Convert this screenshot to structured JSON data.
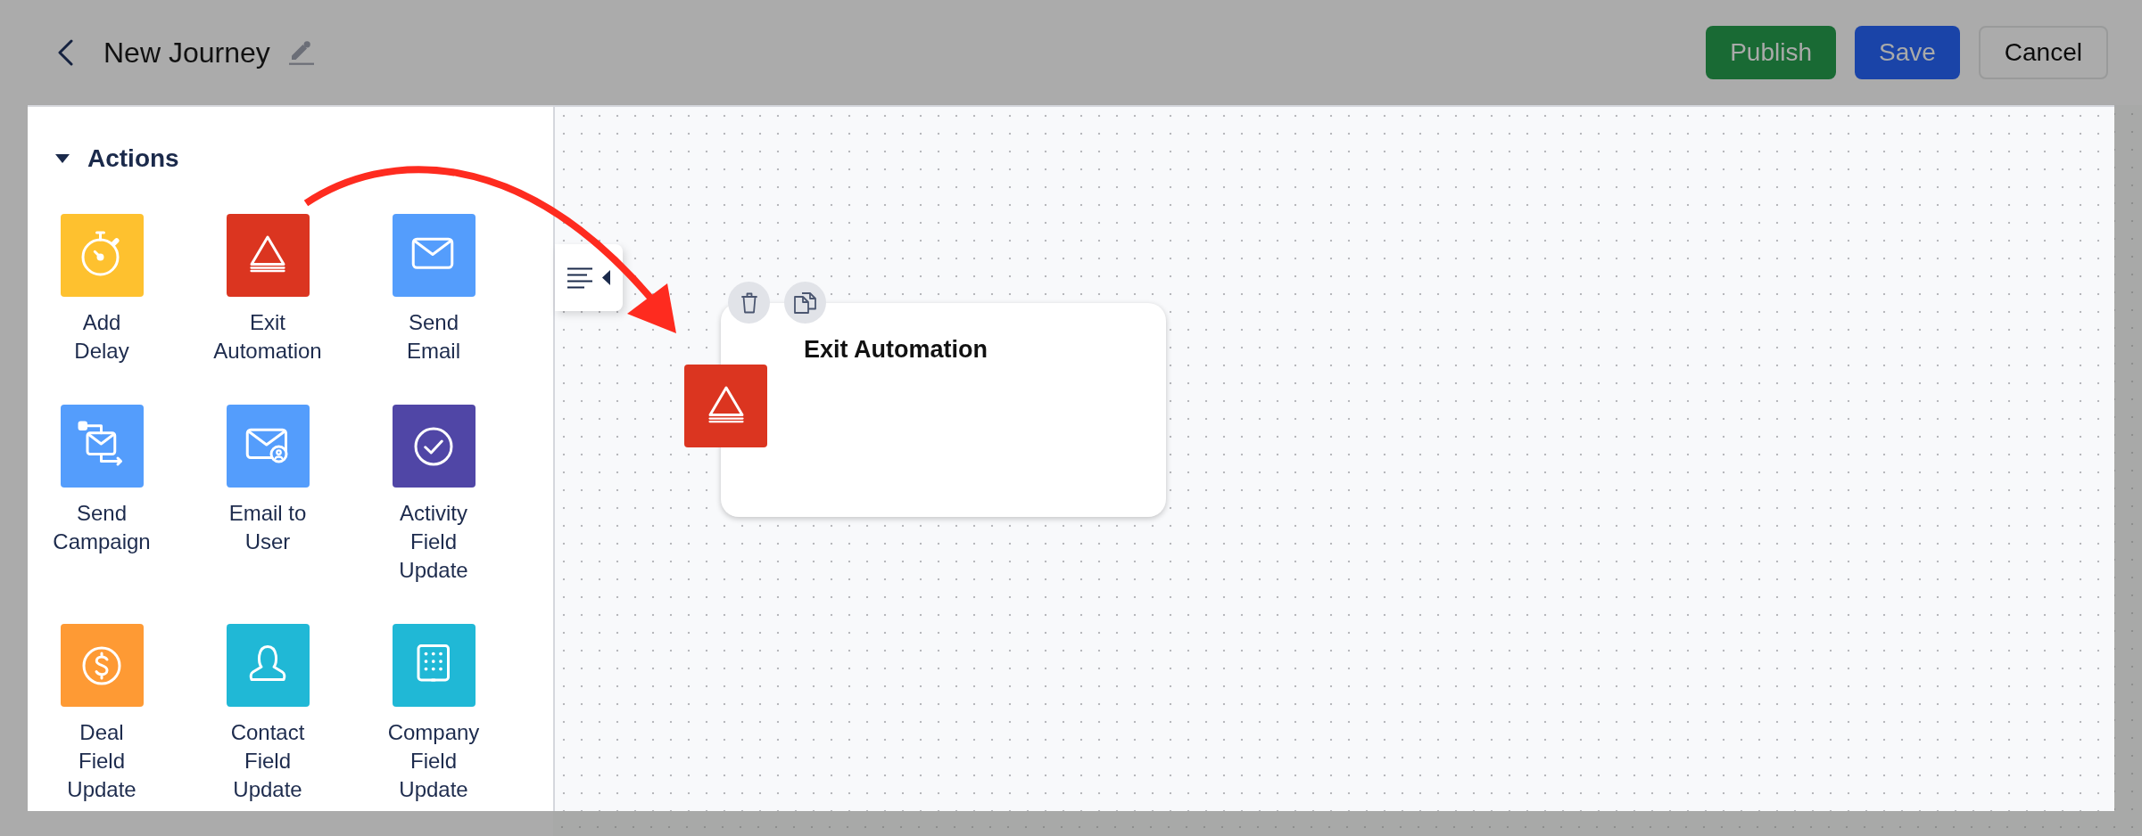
{
  "header": {
    "title": "New Journey",
    "buttons": [
      {
        "label": "Publish",
        "kind": "publish"
      },
      {
        "label": "Save",
        "kind": "save"
      },
      {
        "label": "Cancel",
        "kind": "cancel"
      }
    ]
  },
  "sidebar": {
    "section": {
      "title": "Actions",
      "expanded": true
    },
    "items": [
      {
        "label": "Add Delay",
        "kind": "stopwatch",
        "color": "#fec12f"
      },
      {
        "label": "Exit Automation",
        "kind": "exit",
        "color": "#db3520"
      },
      {
        "label": "Send Email",
        "kind": "email",
        "color": "#549dfc"
      },
      {
        "label": "Send Campaign",
        "kind": "campaign",
        "color": "#549dfc"
      },
      {
        "label": "Email to User",
        "kind": "email_user",
        "color": "#549dfc"
      },
      {
        "label": "Activity Field Update",
        "kind": "check",
        "color": "#5046a6"
      },
      {
        "label": "Deal Field Update",
        "kind": "deal",
        "color": "#fe9a34"
      },
      {
        "label": "Contact Field Update",
        "kind": "contact",
        "color": "#20b8d6"
      },
      {
        "label": "Company Field Update",
        "kind": "company",
        "color": "#20b8d6"
      }
    ]
  },
  "canvas": {
    "node": {
      "title": "Exit Automation",
      "kind": "exit",
      "color": "#db3520"
    }
  }
}
